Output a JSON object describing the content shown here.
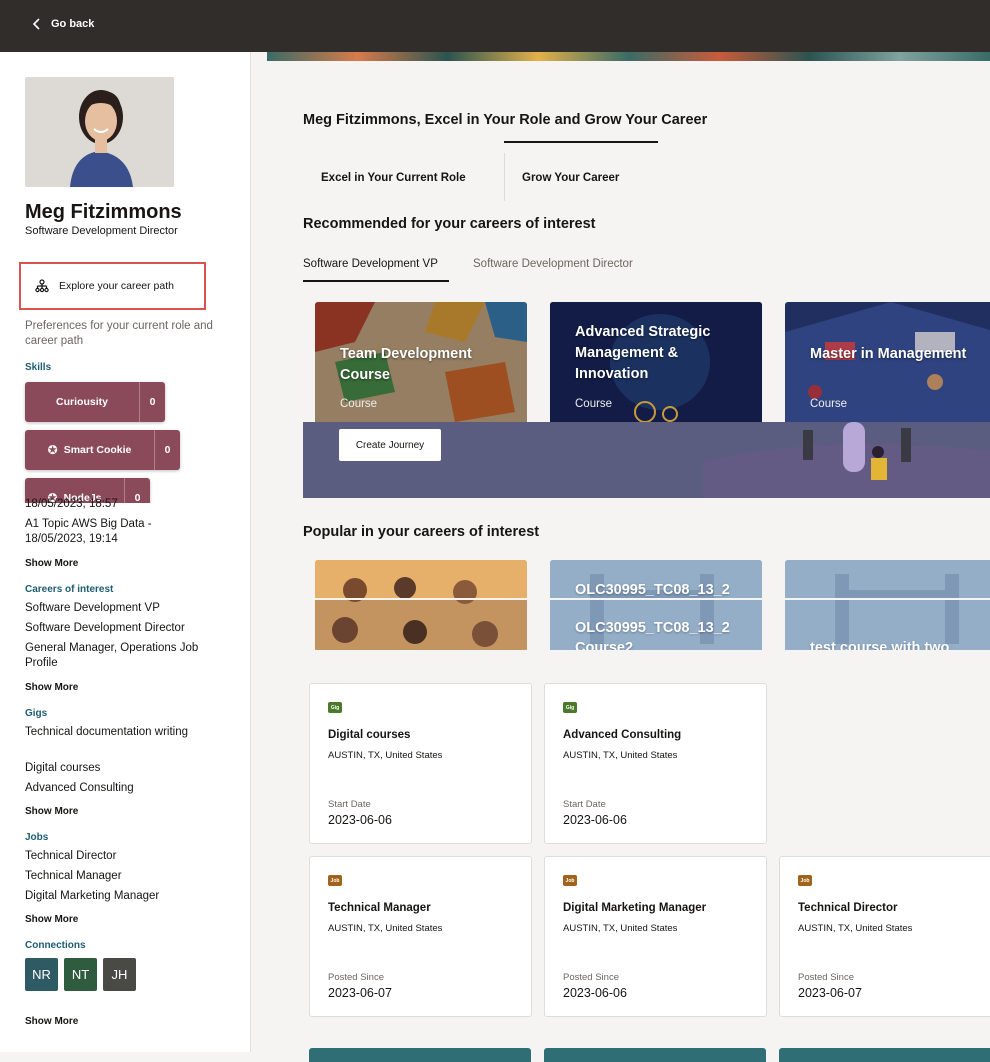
{
  "topbar": {
    "go_back": "Go back"
  },
  "profile": {
    "name": "Meg Fitzimmons",
    "title": "Software Development Director",
    "explore_label": "Explore your career path",
    "preferences": "Preferences for your current role and career path"
  },
  "skills": {
    "label": "Skills",
    "items": [
      {
        "name": "Curiousity",
        "count": "0"
      },
      {
        "name": "Smart Cookie",
        "count": "0"
      },
      {
        "name": "NodeJs",
        "count": "0"
      }
    ],
    "overflow_text_1": "18/05/2023, 18:57",
    "overflow_text_2": "A1 Topic AWS Big Data - 18/05/2023, 19:14",
    "show_more": "Show More"
  },
  "careers": {
    "label": "Careers of interest",
    "items": [
      "Software Development VP",
      "Software Development Director",
      "General Manager, Operations Job Profile"
    ],
    "show_more": "Show More"
  },
  "gigs": {
    "label": "Gigs",
    "items": [
      "Technical documentation writing",
      "Digital courses",
      "Advanced Consulting"
    ],
    "show_more": "Show More"
  },
  "jobs": {
    "label": "Jobs",
    "items": [
      "Technical Director",
      "Technical Manager",
      "Digital Marketing Manager"
    ],
    "show_more": "Show More"
  },
  "connections": {
    "label": "Connections",
    "items": [
      "NR",
      "NT",
      "JH"
    ],
    "show_more": "Show More"
  },
  "main": {
    "heading": "Meg Fitzimmons, Excel in Your Role and Grow Your Career",
    "tabs": [
      "Excel in Your Current Role",
      "Grow Your Career"
    ],
    "recommended_title": "Recommended for your careers of interest",
    "subtabs": [
      "Software Development VP",
      "Software Development Director"
    ],
    "rec_cards": [
      {
        "title": "Team Development Course",
        "type": "Course"
      },
      {
        "title": "Advanced Strategic Management & Innovation",
        "type": "Course"
      },
      {
        "title": "Master in Management",
        "type": "Course"
      }
    ],
    "create_journey": "Create Journey",
    "popular_title": "Popular in your careers of interest",
    "pop_cards": [
      {
        "title": ""
      },
      {
        "title": "OLC30995_TC08_13_2",
        "title2": "OLC30995_TC08_13_2 Course2"
      },
      {
        "title": "test course with two"
      }
    ],
    "info_cards": [
      {
        "badge": "Gig",
        "title": "Digital courses",
        "location": "AUSTIN, TX, United States",
        "date_label": "Start Date",
        "date": "2023-06-06"
      },
      {
        "badge": "Gig",
        "title": "Advanced Consulting",
        "location": "AUSTIN, TX, United States",
        "date_label": "Start Date",
        "date": "2023-06-06"
      },
      {
        "badge": "Job",
        "title": "Technical Manager",
        "location": "AUSTIN, TX, United States",
        "date_label": "Posted Since",
        "date": "2023-06-07"
      },
      {
        "badge": "Job",
        "title": "Digital Marketing Manager",
        "location": "AUSTIN, TX, United States",
        "date_label": "Posted Since",
        "date": "2023-06-06"
      },
      {
        "badge": "Job",
        "title": "Technical Director",
        "location": "AUSTIN, TX, United States",
        "date_label": "Posted Since",
        "date": "2023-06-07"
      }
    ]
  },
  "colors": {
    "gig_badge": "#4a7a2a",
    "job_badge": "#a0631a",
    "skill_chip": "#8b4a5a",
    "section_label": "#1d5c72"
  }
}
